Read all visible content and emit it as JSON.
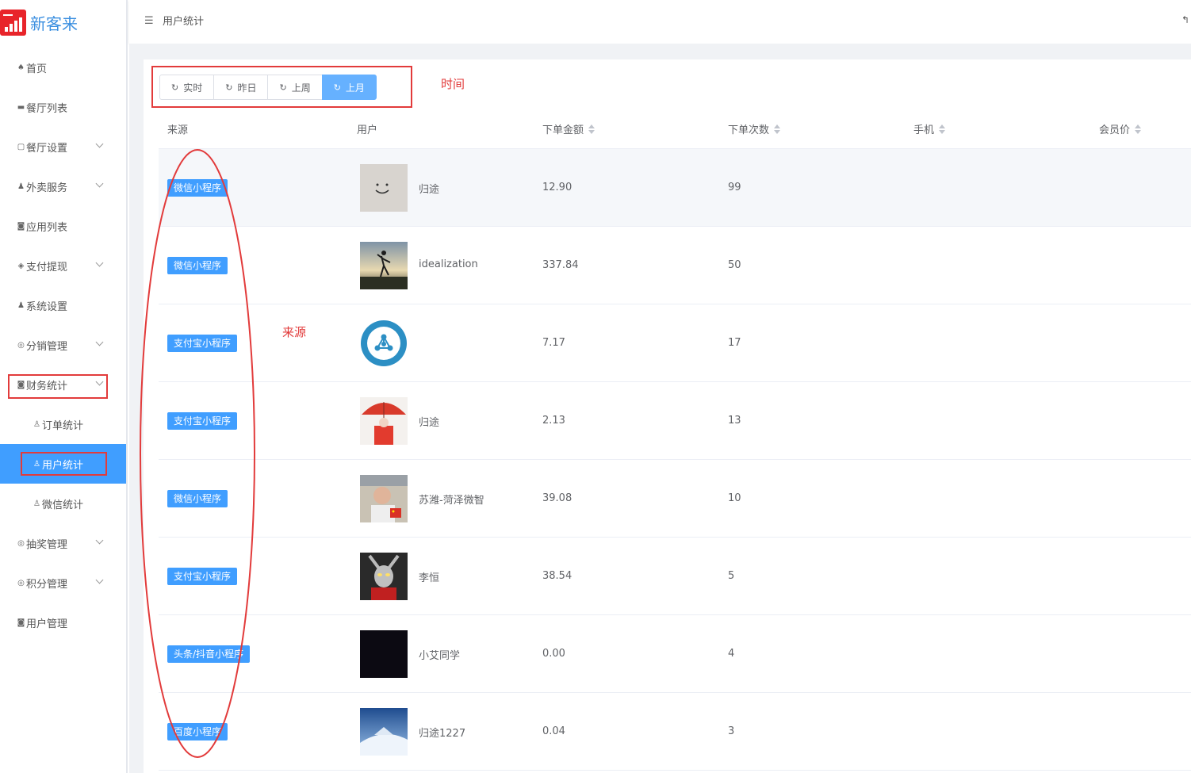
{
  "app": {
    "name": "新客来"
  },
  "sidebar": {
    "items": [
      {
        "label": "首页",
        "icon": "home-icon",
        "glyph": "♠",
        "chevron": false
      },
      {
        "label": "餐厅列表",
        "icon": "list-icon",
        "glyph": "▬",
        "chevron": false
      },
      {
        "label": "餐厅设置",
        "icon": "setting-icon",
        "glyph": "▢",
        "chevron": true
      },
      {
        "label": "外卖服务",
        "icon": "user-icon",
        "glyph": "♟",
        "chevron": true
      },
      {
        "label": "应用列表",
        "icon": "app-icon",
        "glyph": "◙",
        "chevron": false
      },
      {
        "label": "支付提现",
        "icon": "shield-icon",
        "glyph": "◈",
        "chevron": true
      },
      {
        "label": "系统设置",
        "icon": "user-gear-icon",
        "glyph": "♟",
        "chevron": false
      },
      {
        "label": "分销管理",
        "icon": "group-icon",
        "glyph": "◎",
        "chevron": true
      },
      {
        "label": "财务统计",
        "icon": "finance-icon",
        "glyph": "◙",
        "chevron": true
      },
      {
        "label": "订单统计",
        "icon": "person-icon",
        "glyph": "♙",
        "chevron": false,
        "sub": true
      },
      {
        "label": "用户统计",
        "icon": "person-icon",
        "glyph": "♙",
        "chevron": false,
        "sub": true,
        "active": true
      },
      {
        "label": "微信统计",
        "icon": "person-icon",
        "glyph": "♙",
        "chevron": false,
        "sub": true
      },
      {
        "label": "抽奖管理",
        "icon": "group-icon",
        "glyph": "◎",
        "chevron": true
      },
      {
        "label": "积分管理",
        "icon": "group-icon",
        "glyph": "◎",
        "chevron": true
      },
      {
        "label": "用户管理",
        "icon": "user-manage-icon",
        "glyph": "◙",
        "chevron": false
      }
    ]
  },
  "topbar": {
    "breadcrumb": "用户统计",
    "back_glyph": "↰"
  },
  "filters": {
    "buttons": [
      {
        "label": "实时",
        "active": false
      },
      {
        "label": "昨日",
        "active": false
      },
      {
        "label": "上周",
        "active": false
      },
      {
        "label": "上月",
        "active": true
      }
    ]
  },
  "annotations": {
    "time": "时间",
    "source": "来源"
  },
  "table": {
    "columns": [
      {
        "label": "来源",
        "sortable": false
      },
      {
        "label": "用户",
        "sortable": false
      },
      {
        "label": "下单金额",
        "sortable": true
      },
      {
        "label": "下单次数",
        "sortable": true
      },
      {
        "label": "手机",
        "sortable": true
      },
      {
        "label": "会员价",
        "sortable": true
      }
    ],
    "rows": [
      {
        "source": "微信小程序",
        "user": "归途",
        "amount": "12.90",
        "count": "99",
        "avatar": "smiley"
      },
      {
        "source": "微信小程序",
        "user": "idealization",
        "amount": "337.84",
        "count": "50",
        "avatar": "sunset"
      },
      {
        "source": "支付宝小程序",
        "user": "",
        "amount": "7.17",
        "count": "17",
        "avatar": "logo-circle"
      },
      {
        "source": "支付宝小程序",
        "user": "归途",
        "amount": "2.13",
        "count": "13",
        "avatar": "umbrella"
      },
      {
        "source": "微信小程序",
        "user": "苏潍-菏泽微智",
        "amount": "39.08",
        "count": "10",
        "avatar": "portrait"
      },
      {
        "source": "支付宝小程序",
        "user": "李恒",
        "amount": "38.54",
        "count": "5",
        "avatar": "hero"
      },
      {
        "source": "头条/抖音小程序",
        "user": "小艾同学",
        "amount": "0.00",
        "count": "4",
        "avatar": "dark"
      },
      {
        "source": "百度小程序",
        "user": "归途1227",
        "amount": "0.04",
        "count": "3",
        "avatar": "snow"
      }
    ]
  },
  "colors": {
    "primary": "#409eff",
    "annotation": "#e23b3b",
    "logo": "#e8242a"
  }
}
